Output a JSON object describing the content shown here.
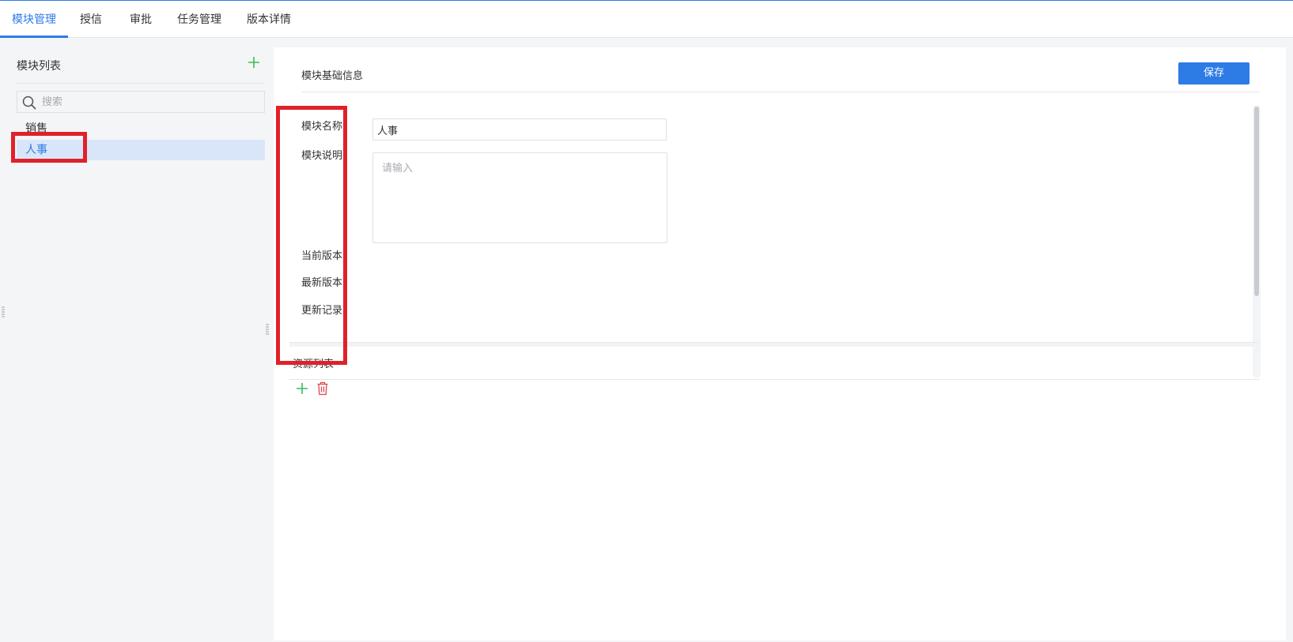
{
  "tabs": [
    {
      "label": "模块管理",
      "active": true
    },
    {
      "label": "授信",
      "active": false
    },
    {
      "label": "审批",
      "active": false
    },
    {
      "label": "任务管理",
      "active": false
    },
    {
      "label": "版本详情",
      "active": false
    }
  ],
  "sidebar": {
    "title": "模块列表",
    "search_placeholder": "搜索",
    "items": [
      {
        "label": "销售",
        "selected": false
      },
      {
        "label": "人事",
        "selected": true
      }
    ]
  },
  "main": {
    "section_title": "模块基础信息",
    "save_label": "保存",
    "form": {
      "name_label": "模块名称",
      "name_value": "人事",
      "desc_label": "模块说明",
      "desc_placeholder": "请输入",
      "current_version_label": "当前版本",
      "latest_version_label": "最新版本",
      "update_log_label": "更新记录"
    },
    "resources_title": "资源列表"
  },
  "icons": [
    "plus-icon",
    "search-icon",
    "delete-icon",
    "drag-handle-icon"
  ],
  "colors": {
    "accent": "#2d7be5",
    "add_green": "#3bbb5c",
    "delete_red": "#e0464b",
    "highlight_red": "#e0212a",
    "selected_bg": "#d9e6fa"
  }
}
